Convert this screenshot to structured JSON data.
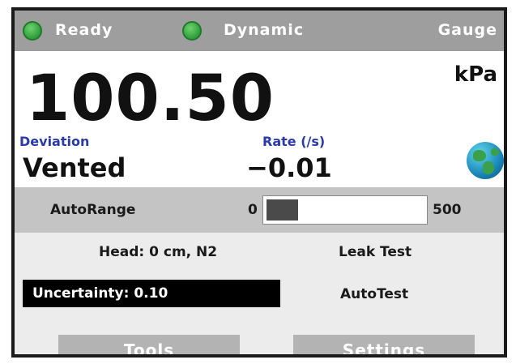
{
  "status_bar": {
    "ready_label": "Ready",
    "mode_label": "Dynamic",
    "reference_label": "Gauge",
    "led_color": "#2f9e3a"
  },
  "reading": {
    "value": "100.50",
    "unit": "kPa",
    "deviation_label": "Deviation",
    "deviation_value": "Vented",
    "rate_label": "Rate (/s)",
    "rate_value": "−0.01",
    "globe_icon": "globe-icon"
  },
  "autorange": {
    "label": "AutoRange",
    "min": "0",
    "max": "500",
    "fill_fraction": 0.2
  },
  "info": {
    "head": "Head: 0 cm, N2",
    "leak_test": "Leak Test",
    "uncertainty": "Uncertainty: 0.10",
    "autotest": "AutoTest"
  },
  "softkeys": {
    "tools": "Tools",
    "settings": "Settings"
  },
  "colors": {
    "accent_blue": "#2a3aa8",
    "status_bar": "#9e9e9e"
  }
}
